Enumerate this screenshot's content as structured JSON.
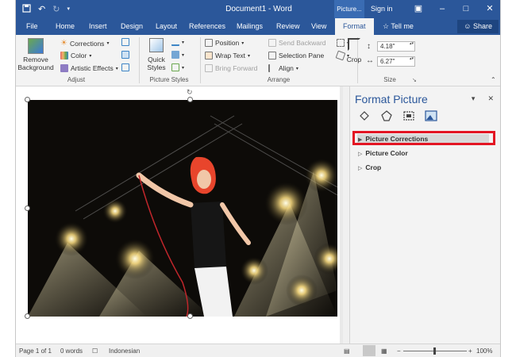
{
  "titlebar": {
    "document_title": "Document1 - Word",
    "context_tab_group": "Picture...",
    "signin": "Sign in"
  },
  "tabs": [
    "File",
    "Home",
    "Insert",
    "Design",
    "Layout",
    "References",
    "Mailings",
    "Review",
    "View",
    "Format"
  ],
  "active_tab": "Format",
  "tellme": "Tell me",
  "share": "Share",
  "ribbon": {
    "adjust": {
      "remove_background": "Remove Background",
      "corrections": "Corrections",
      "color": "Color",
      "artistic_effects": "Artistic Effects",
      "group_label": "Adjust"
    },
    "picture_styles": {
      "quick_styles": "Quick Styles",
      "group_label": "Picture Styles"
    },
    "arrange": {
      "position": "Position",
      "wrap_text": "Wrap Text",
      "bring_forward": "Bring Forward",
      "send_backward": "Send Backward",
      "selection_pane": "Selection Pane",
      "align": "Align",
      "group_label": "Arrange"
    },
    "size": {
      "crop": "Crop",
      "height": "4.18\"",
      "width": "6.27\"",
      "group_label": "Size"
    }
  },
  "pane": {
    "title": "Format Picture",
    "sections": [
      "Picture Corrections",
      "Picture Color",
      "Crop"
    ]
  },
  "statusbar": {
    "page": "Page 1 of 1",
    "words": "0 words",
    "language": "Indonesian",
    "zoom": "100%"
  },
  "colors": {
    "brand": "#2b579a",
    "highlight": "#e31523"
  }
}
